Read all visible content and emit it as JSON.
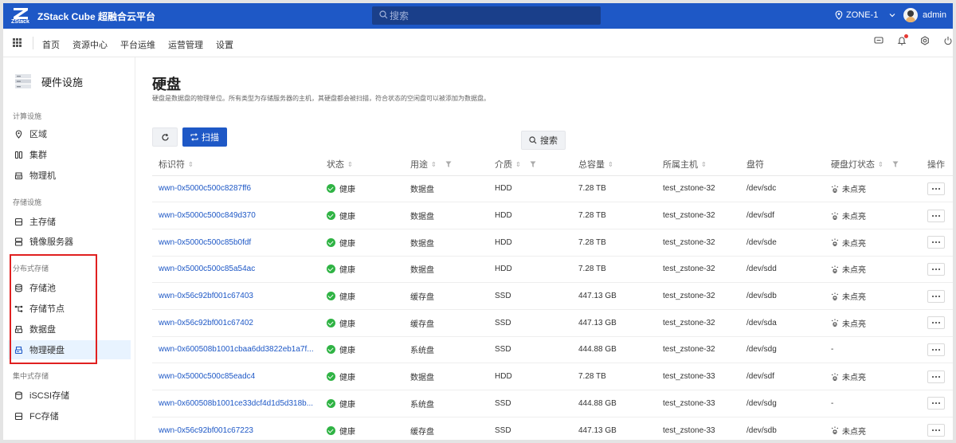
{
  "app": {
    "logo_text": "ZStack",
    "brand": "ZStack Cube 超融合云平台",
    "search_placeholder": "搜索",
    "zone": "ZONE-1",
    "user": "admin",
    "brand_color": "#1e58c6"
  },
  "nav": {
    "items": [
      "首页",
      "资源中心",
      "平台运维",
      "运营管理",
      "设置"
    ],
    "right_icons": [
      "message-icon",
      "bell-icon",
      "hexagon-settings-icon",
      "power-icon"
    ]
  },
  "sidebar": {
    "title": "硬件设施",
    "groups": [
      {
        "label": "计算设施",
        "items": [
          {
            "label": "区域",
            "icon": "location-icon"
          },
          {
            "label": "集群",
            "icon": "cluster-icon"
          },
          {
            "label": "物理机",
            "icon": "host-icon"
          }
        ]
      },
      {
        "label": "存储设施",
        "items": [
          {
            "label": "主存储",
            "icon": "storage-icon"
          },
          {
            "label": "镜像服务器",
            "icon": "image-server-icon"
          }
        ]
      },
      {
        "label": "分布式存储",
        "items": [
          {
            "label": "存储池",
            "icon": "database-icon"
          },
          {
            "label": "存储节点",
            "icon": "node-icon"
          },
          {
            "label": "数据盘",
            "icon": "disk-icon"
          },
          {
            "label": "物理硬盘",
            "icon": "disk-icon",
            "active": true
          }
        ]
      },
      {
        "label": "集中式存储",
        "items": [
          {
            "label": "iSCSI存储",
            "icon": "iscsi-icon"
          },
          {
            "label": "FC存储",
            "icon": "fc-icon"
          }
        ]
      }
    ]
  },
  "page": {
    "title": "硬盘",
    "description": "硬盘是数据盘的物理单位。所有类型为存储服务器的主机，其硬盘都会被扫描，符合状态的空闲盘可以被添加为数据盘。",
    "toolbar": {
      "scan": "扫描",
      "search": "搜索"
    }
  },
  "table": {
    "columns": [
      "标识符",
      "状态",
      "用途",
      "介质",
      "总容量",
      "所属主机",
      "盘符",
      "硬盘灯状态",
      "操作"
    ],
    "rows": [
      {
        "id": "wwn-0x5000c500c8287ff6",
        "status": "健康",
        "usage": "数据盘",
        "medium": "HDD",
        "capacity": "7.28 TB",
        "host": "test_zstone-32",
        "device": "/dev/sdc",
        "light": "未点亮"
      },
      {
        "id": "wwn-0x5000c500c849d370",
        "status": "健康",
        "usage": "数据盘",
        "medium": "HDD",
        "capacity": "7.28 TB",
        "host": "test_zstone-32",
        "device": "/dev/sdf",
        "light": "未点亮"
      },
      {
        "id": "wwn-0x5000c500c85b0fdf",
        "status": "健康",
        "usage": "数据盘",
        "medium": "HDD",
        "capacity": "7.28 TB",
        "host": "test_zstone-32",
        "device": "/dev/sde",
        "light": "未点亮"
      },
      {
        "id": "wwn-0x5000c500c85a54ac",
        "status": "健康",
        "usage": "数据盘",
        "medium": "HDD",
        "capacity": "7.28 TB",
        "host": "test_zstone-32",
        "device": "/dev/sdd",
        "light": "未点亮"
      },
      {
        "id": "wwn-0x56c92bf001c67403",
        "status": "健康",
        "usage": "缓存盘",
        "medium": "SSD",
        "capacity": "447.13 GB",
        "host": "test_zstone-32",
        "device": "/dev/sdb",
        "light": "未点亮"
      },
      {
        "id": "wwn-0x56c92bf001c67402",
        "status": "健康",
        "usage": "缓存盘",
        "medium": "SSD",
        "capacity": "447.13 GB",
        "host": "test_zstone-32",
        "device": "/dev/sda",
        "light": "未点亮"
      },
      {
        "id": "wwn-0x600508b1001cbaa6dd3822eb1a7f...",
        "status": "健康",
        "usage": "系统盘",
        "medium": "SSD",
        "capacity": "444.88 GB",
        "host": "test_zstone-32",
        "device": "/dev/sdg",
        "light": "-"
      },
      {
        "id": "wwn-0x5000c500c85eadc4",
        "status": "健康",
        "usage": "数据盘",
        "medium": "HDD",
        "capacity": "7.28 TB",
        "host": "test_zstone-33",
        "device": "/dev/sdf",
        "light": "未点亮"
      },
      {
        "id": "wwn-0x600508b1001ce33dcf4d1d5d318b...",
        "status": "健康",
        "usage": "系统盘",
        "medium": "SSD",
        "capacity": "444.88 GB",
        "host": "test_zstone-33",
        "device": "/dev/sdg",
        "light": "-"
      },
      {
        "id": "wwn-0x56c92bf001c67223",
        "status": "健康",
        "usage": "缓存盘",
        "medium": "SSD",
        "capacity": "447.13 GB",
        "host": "test_zstone-33",
        "device": "/dev/sdb",
        "light": "未点亮"
      }
    ]
  }
}
